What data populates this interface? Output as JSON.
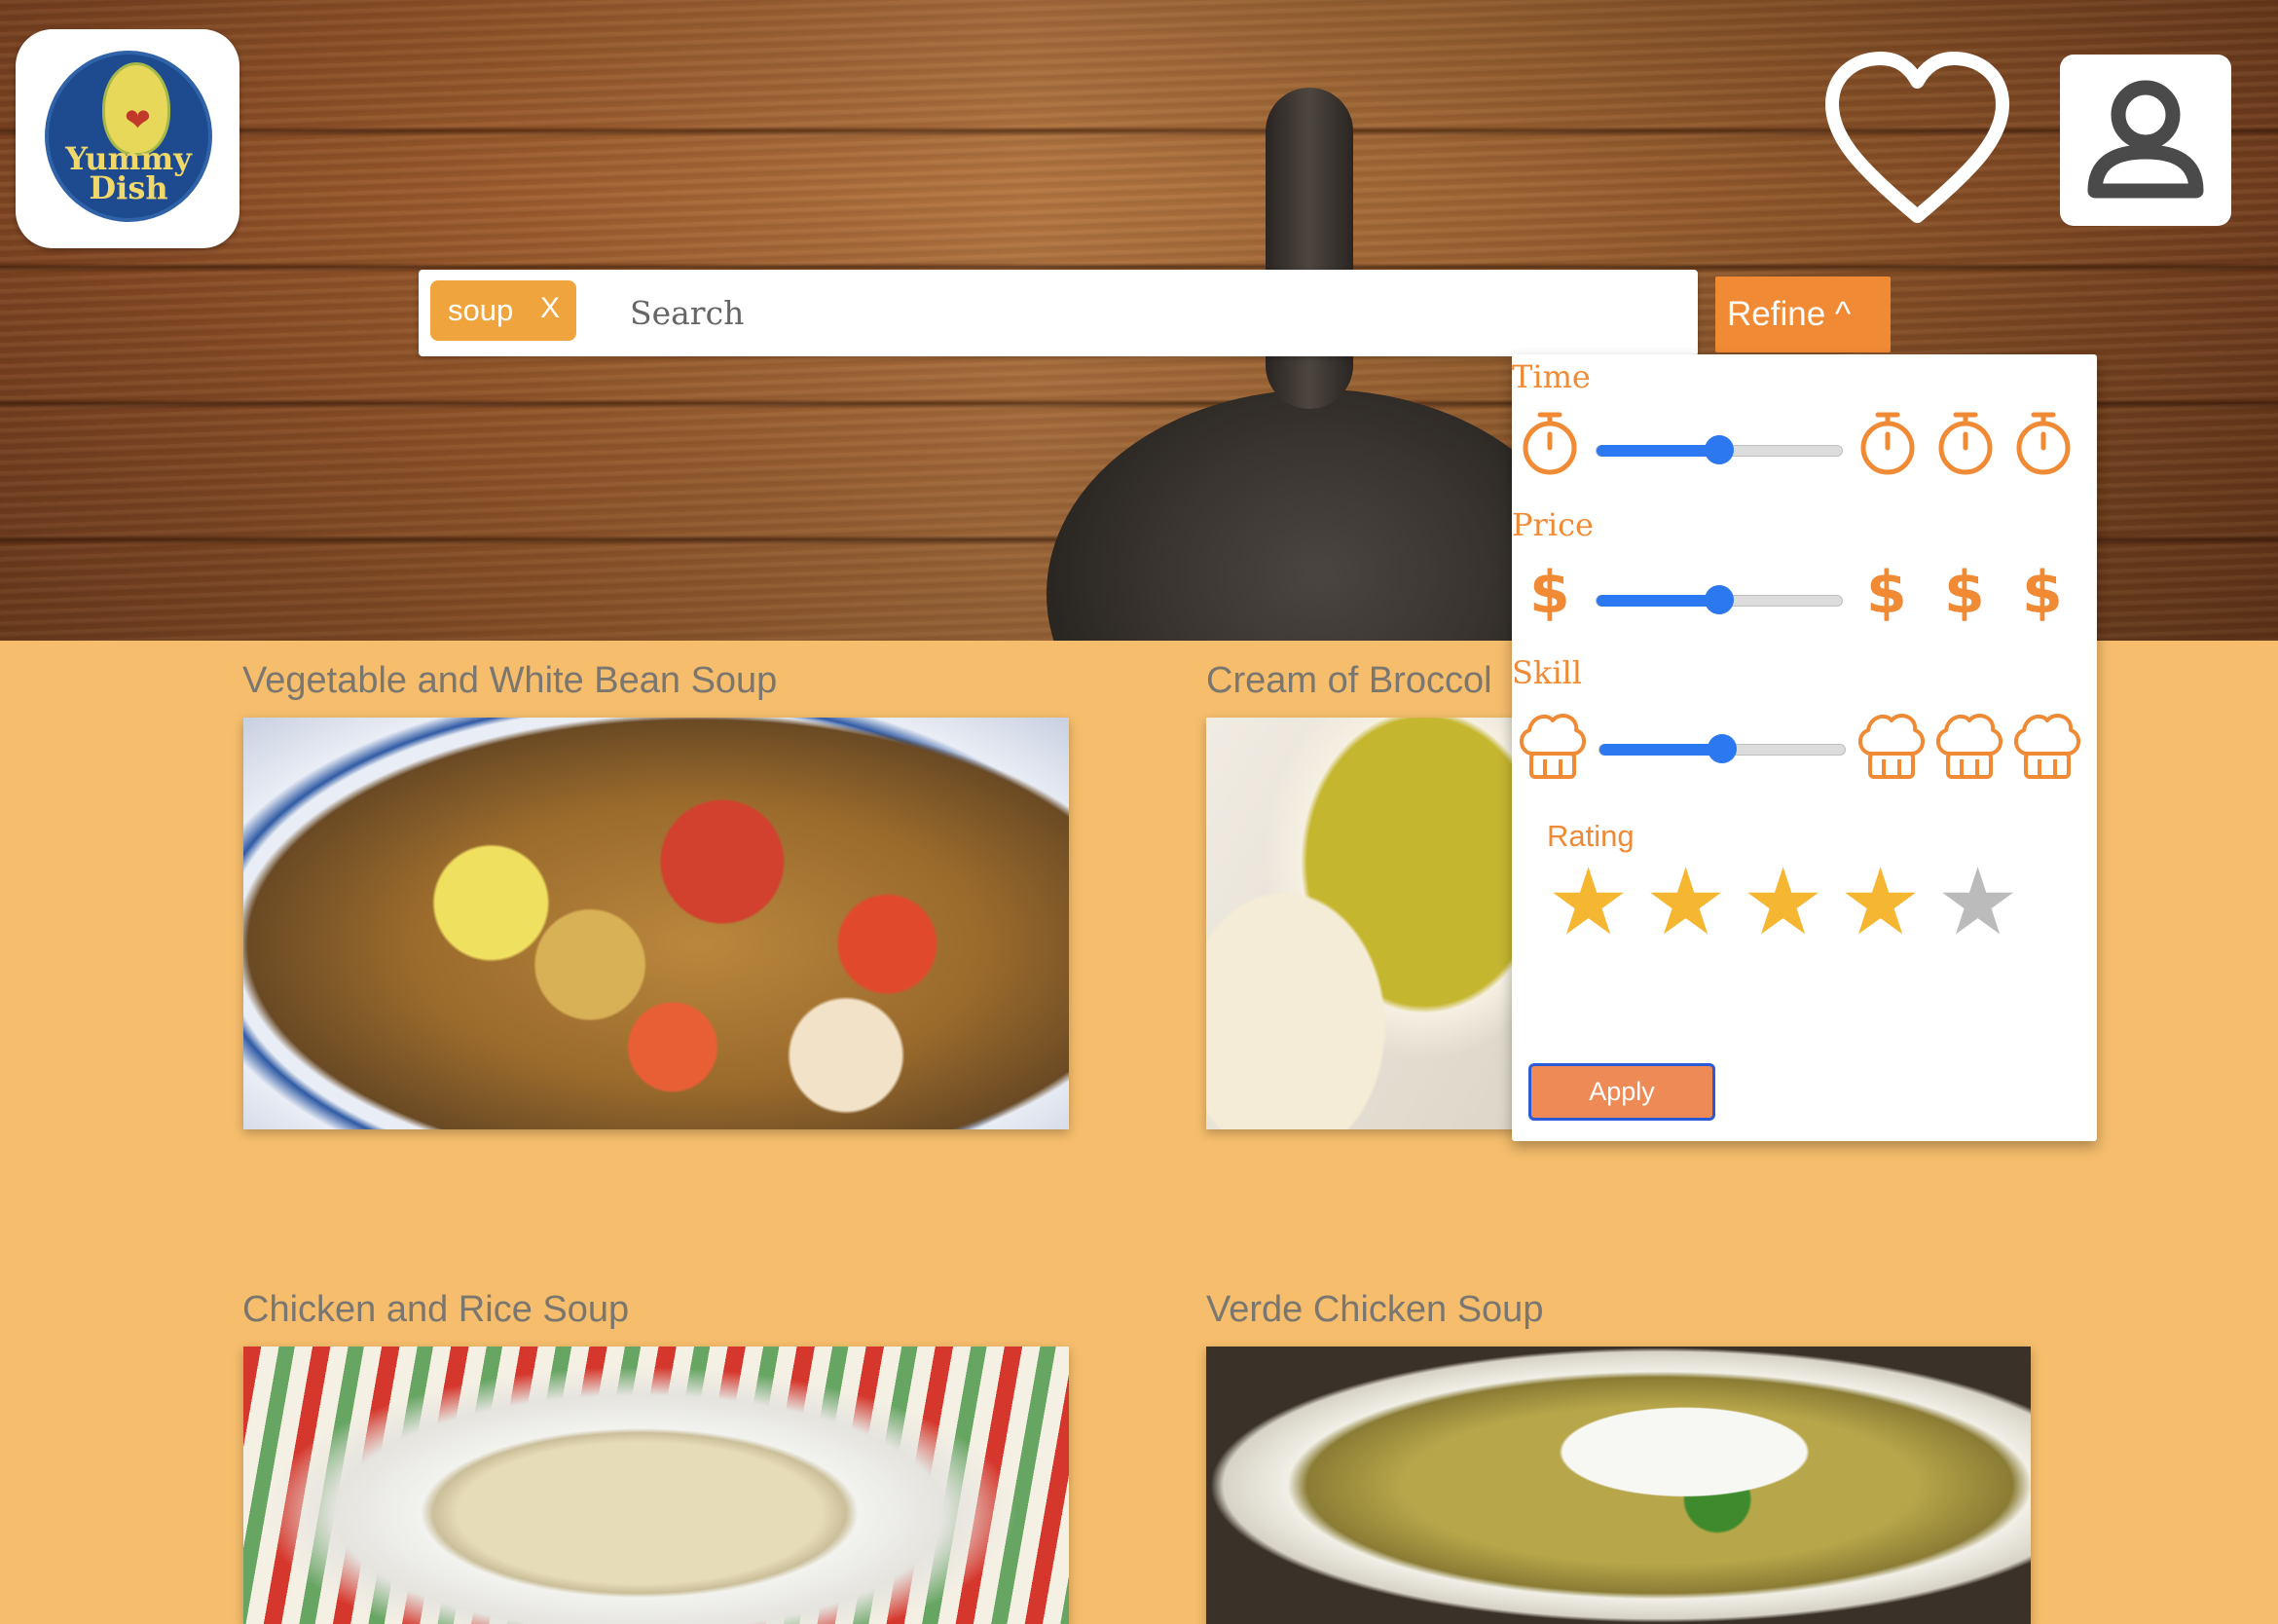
{
  "brand": {
    "logo_text_line1": "Yummy",
    "logo_text_line2": "Dish"
  },
  "header": {
    "favorites_icon": "heart-icon",
    "profile_icon": "user-icon"
  },
  "search": {
    "placeholder": "Search",
    "value": "",
    "chips": [
      {
        "label": "soup",
        "remove": "X"
      }
    ]
  },
  "refine": {
    "button_label": "Refine ^",
    "expanded": true,
    "filters": {
      "time": {
        "label": "Time",
        "icon": "stopwatch-icon",
        "value_percent": 50,
        "max_icons": 3
      },
      "price": {
        "label": "Price",
        "icon": "dollar-icon",
        "symbol": "$",
        "value_percent": 50,
        "max_icons": 3
      },
      "skill": {
        "label": "Skill",
        "icon": "chef-hat-icon",
        "value_percent": 50,
        "max_icons": 3
      }
    },
    "rating": {
      "label": "Rating",
      "value": 4,
      "max": 5
    },
    "apply_label": "Apply"
  },
  "recipes": [
    {
      "title": "Vegetable and White Bean Soup"
    },
    {
      "title": "Cream of Broccol"
    },
    {
      "title": "Chicken and Rice Soup"
    },
    {
      "title": "Verde Chicken Soup"
    }
  ],
  "colors": {
    "background": "#f5bd6c",
    "accent": "#f08a35",
    "chip": "#f0a43d",
    "slider": "#2b78f0",
    "star_on": "#f5b731",
    "star_off": "#bbbbbb"
  }
}
